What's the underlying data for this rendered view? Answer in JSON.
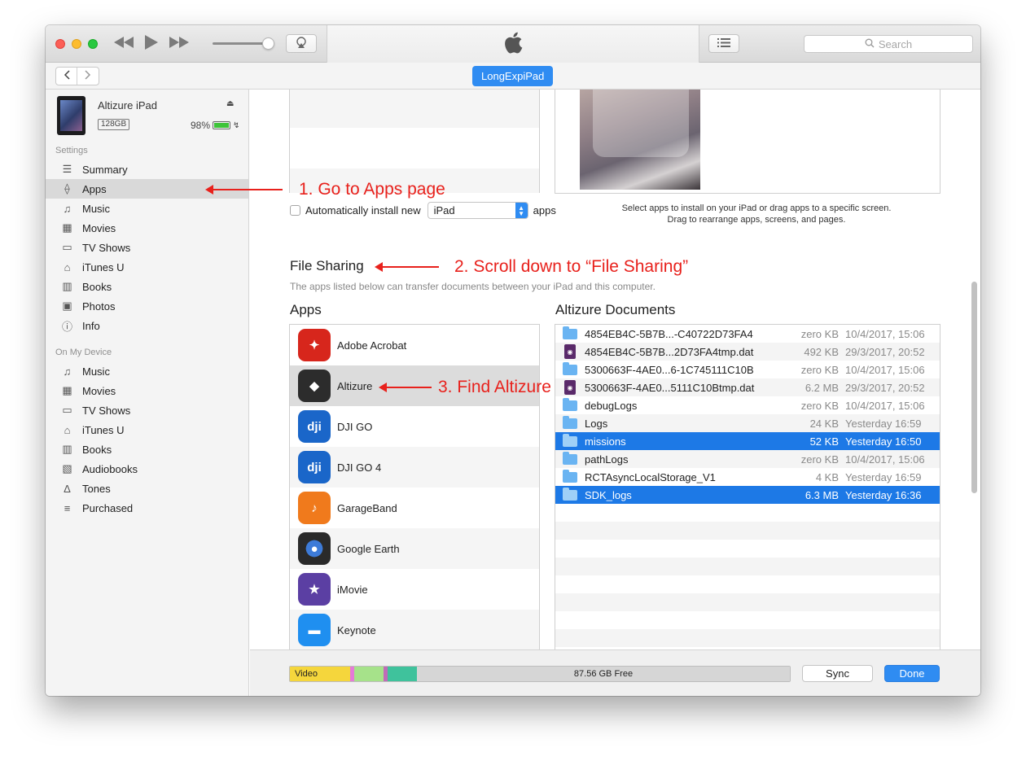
{
  "toolbar": {
    "search_placeholder": "Search"
  },
  "navbar": {
    "device_name": "LongExpiPad"
  },
  "device": {
    "name": "Altizure iPad",
    "capacity": "128GB",
    "battery": "98%",
    "battery_level": 0.98
  },
  "sidebar": {
    "settings_label": "Settings",
    "settings_items": [
      {
        "label": "Summary",
        "icon": "summary-icon"
      },
      {
        "label": "Apps",
        "icon": "apps-icon"
      },
      {
        "label": "Music",
        "icon": "music-icon"
      },
      {
        "label": "Movies",
        "icon": "movies-icon"
      },
      {
        "label": "TV Shows",
        "icon": "tv-icon"
      },
      {
        "label": "iTunes U",
        "icon": "itunes-u-icon"
      },
      {
        "label": "Books",
        "icon": "books-icon"
      },
      {
        "label": "Photos",
        "icon": "photos-icon"
      },
      {
        "label": "Info",
        "icon": "info-icon"
      }
    ],
    "device_label": "On My Device",
    "device_items": [
      {
        "label": "Music",
        "icon": "music-icon"
      },
      {
        "label": "Movies",
        "icon": "movies-icon"
      },
      {
        "label": "TV Shows",
        "icon": "tv-icon"
      },
      {
        "label": "iTunes U",
        "icon": "itunes-u-icon"
      },
      {
        "label": "Books",
        "icon": "books-icon"
      },
      {
        "label": "Audiobooks",
        "icon": "audiobooks-icon"
      },
      {
        "label": "Tones",
        "icon": "tones-icon"
      },
      {
        "label": "Purchased",
        "icon": "purchased-icon"
      }
    ]
  },
  "apps_section": {
    "auto_install_label": "Automatically install new",
    "auto_install_select": "iPad",
    "auto_install_suffix": "apps",
    "hint_line1": "Select apps to install on your iPad or drag apps to a specific screen.",
    "hint_line2": "Drag to rearrange apps, screens, and pages."
  },
  "file_sharing": {
    "title": "File Sharing",
    "description": "The apps listed below can transfer documents between your iPad and this computer.",
    "apps_title": "Apps",
    "docs_title": "Altizure Documents",
    "apps": [
      {
        "name": "Adobe Acrobat",
        "color": "#d7261c"
      },
      {
        "name": "Altizure",
        "color": "#2c2c2c"
      },
      {
        "name": "DJI GO",
        "color": "#1a66c9"
      },
      {
        "name": "DJI GO 4",
        "color": "#1a66c9"
      },
      {
        "name": "GarageBand",
        "color": "#f07a1c"
      },
      {
        "name": "Google Earth",
        "color": "#2a2a2a"
      },
      {
        "name": "iMovie",
        "color": "#5b3fa3"
      },
      {
        "name": "Keynote",
        "color": "#1f8ff0"
      }
    ],
    "documents": [
      {
        "name": "4854EB4C-5B7B...-C40722D73FA4",
        "size": "zero KB",
        "date": "10/4/2017, 15:06",
        "kind": "folder"
      },
      {
        "name": "4854EB4C-5B7B...2D73FA4tmp.dat",
        "size": "492 KB",
        "date": "29/3/2017, 20:52",
        "kind": "dat"
      },
      {
        "name": "5300663F-4AE0...6-1C745111C10B",
        "size": "zero KB",
        "date": "10/4/2017, 15:06",
        "kind": "folder"
      },
      {
        "name": "5300663F-4AE0...5111C10Btmp.dat",
        "size": "6.2 MB",
        "date": "29/3/2017, 20:52",
        "kind": "dat"
      },
      {
        "name": "debugLogs",
        "size": "zero KB",
        "date": "10/4/2017, 15:06",
        "kind": "folder"
      },
      {
        "name": "Logs",
        "size": "24 KB",
        "date": "Yesterday 16:59",
        "kind": "folder"
      },
      {
        "name": "missions",
        "size": "52 KB",
        "date": "Yesterday 16:50",
        "kind": "folder"
      },
      {
        "name": "pathLogs",
        "size": "zero KB",
        "date": "10/4/2017, 15:06",
        "kind": "folder"
      },
      {
        "name": "RCTAsyncLocalStorage_V1",
        "size": "4 KB",
        "date": "Yesterday 16:59",
        "kind": "folder"
      },
      {
        "name": "SDK_logs",
        "size": "6.3 MB",
        "date": "Yesterday 16:36",
        "kind": "folder"
      }
    ]
  },
  "bottom": {
    "video_label": "Video",
    "free_label": "87.56 GB Free",
    "sync_label": "Sync",
    "done_label": "Done"
  },
  "annotations": {
    "step1": "1. Go to Apps page",
    "step2": "2. Scroll down to “File Sharing”",
    "step3": "3. Find Altizure"
  }
}
